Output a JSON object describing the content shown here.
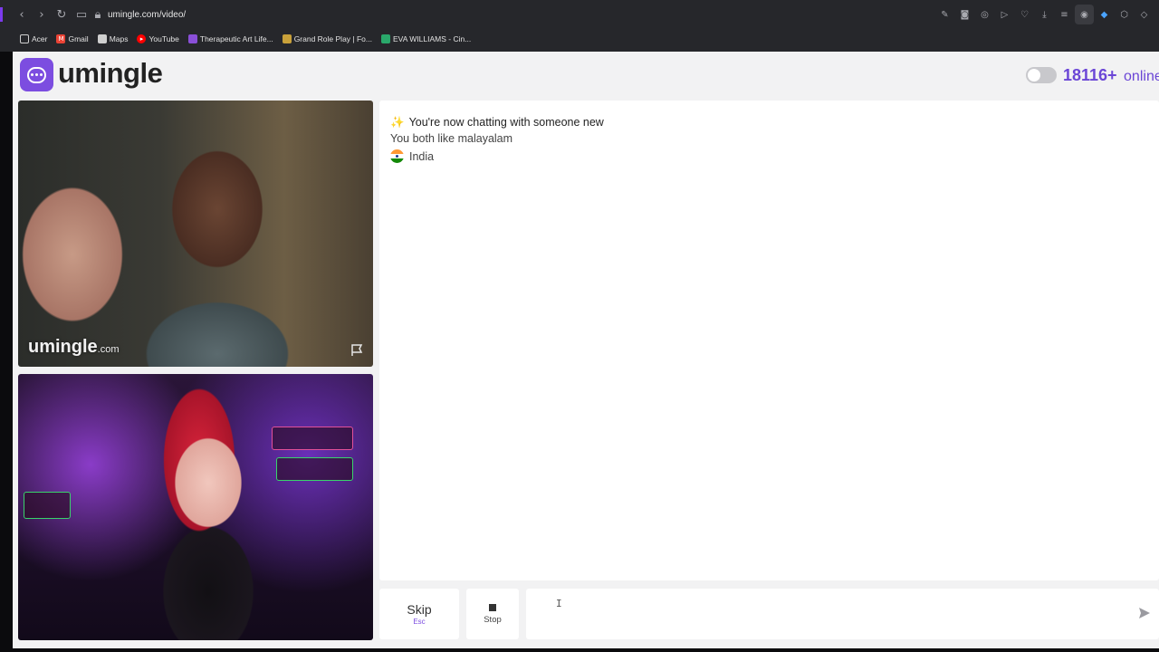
{
  "browser": {
    "url": "umingle.com/video/",
    "bookmarks": [
      {
        "label": "Acer",
        "icon": "folder-icon",
        "color": "#cfcfcf"
      },
      {
        "label": "Gmail",
        "icon": "gmail-icon",
        "color": "#ea4335"
      },
      {
        "label": "Maps",
        "icon": "maps-icon",
        "color": "#cfcfcf"
      },
      {
        "label": "YouTube",
        "icon": "youtube-icon",
        "color": "#ff0000"
      },
      {
        "label": "Therapeutic Art Life...",
        "icon": "site-icon",
        "color": "#8a4fd8"
      },
      {
        "label": "Grand Role Play | Fo...",
        "icon": "site-icon",
        "color": "#c9a13a"
      },
      {
        "label": "EVA WILLIAMS - Cin...",
        "icon": "site-icon",
        "color": "#2aa86b"
      }
    ]
  },
  "header": {
    "brand": "umingle",
    "online_count": "18116+",
    "online_label": "online",
    "accent_color": "#7c4de0"
  },
  "video": {
    "watermark_main": "umingle",
    "watermark_suffix": ".com"
  },
  "chat": {
    "title": "You're now chatting with someone new",
    "interest": "You both like malayalam",
    "country": "India"
  },
  "controls": {
    "skip_label": "Skip",
    "skip_hint": "Esc",
    "stop_label": "Stop",
    "message_placeholder": ""
  }
}
